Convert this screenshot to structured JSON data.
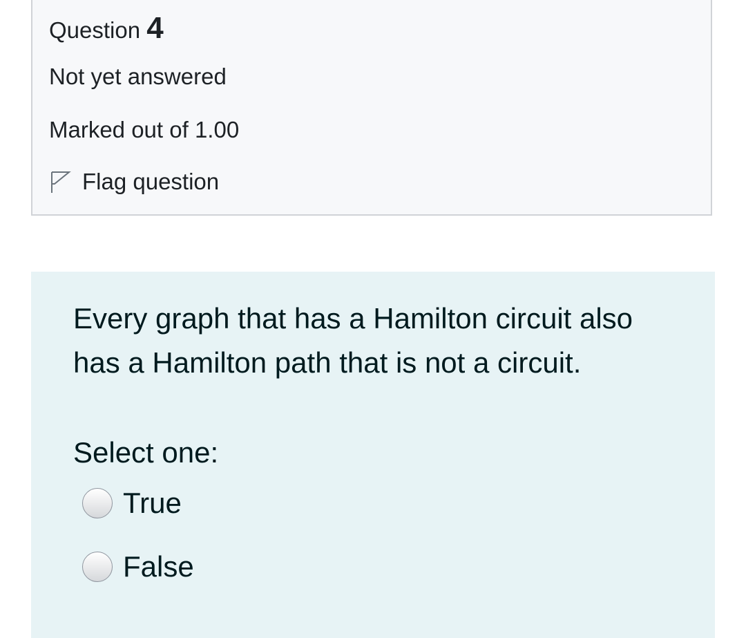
{
  "question_info": {
    "label": "Question",
    "number": "4",
    "state": "Not yet answered",
    "grade": "Marked out of 1.00",
    "flag_label": "Flag question",
    "flag_icon": "flag-outline-icon"
  },
  "question": {
    "text": "Every graph that has a Hamilton circuit also has a Hamilton path that is not a circuit.",
    "prompt": "Select one:",
    "options": [
      {
        "label": "True",
        "selected": false
      },
      {
        "label": "False",
        "selected": false
      }
    ]
  },
  "colors": {
    "info_background": "#f7f8fa",
    "info_border": "#d0d3d7",
    "content_background": "#e7f3f5",
    "text": "#1d2125"
  }
}
